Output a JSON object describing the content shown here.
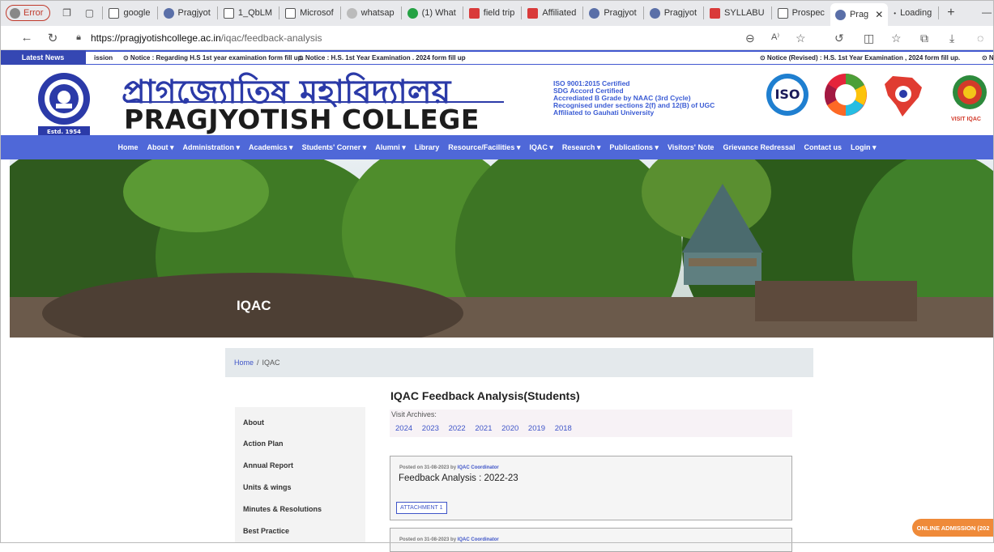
{
  "browser": {
    "error_label": "Error",
    "tabs": [
      {
        "label": "google",
        "icon": "doc"
      },
      {
        "label": "Pragjyot",
        "icon": "globe"
      },
      {
        "label": "1_QbLM",
        "icon": "doc"
      },
      {
        "label": "Microsof",
        "icon": "doc"
      },
      {
        "label": "whatsap",
        "icon": "search"
      },
      {
        "label": "(1) What",
        "icon": "whatsapp"
      },
      {
        "label": "field trip",
        "icon": "pdf"
      },
      {
        "label": "Affiliated",
        "icon": "pdf"
      },
      {
        "label": "Pragjyot",
        "icon": "globe"
      },
      {
        "label": "Pragjyot",
        "icon": "globe"
      },
      {
        "label": "SYLLABU",
        "icon": "pdf"
      },
      {
        "label": "Prospec",
        "icon": "doc"
      }
    ],
    "active_tab": "Prag",
    "loading_tab": "Loading",
    "url_host": "https://pragjyotishcollege.ac.in",
    "url_path": "/iqac/feedback-analysis"
  },
  "news": {
    "label": "Latest News",
    "items": [
      "ission",
      "⊙ Notice : Regarding H.S 1st year examination form fill up.",
      "⊙ Notice : H.S. 1st Year Examination . 2024 form fill up",
      "⊙ Notice (Revised) : H.S. 1st Year Examination , 2024 form fill up.",
      "⊙ N"
    ]
  },
  "header": {
    "title_bn": "প্রাগজ্যোতিষ মহাবিদ্যালয়",
    "title_en": "PRAGJYOTISH COLLEGE",
    "estd": "Estd. 1954",
    "accreditations": [
      "ISO 9001:2015 Certified",
      "SDG Accord Certified",
      "Accrediated B Grade by NAAC (3rd Cycle)",
      "Recognised under sections 2(f) and 12(B) of UGC",
      "Affiliated to Gauhati University"
    ],
    "iso_label": "ISO",
    "visit_iqac": "VISIT IQAC"
  },
  "nav": [
    "Home",
    "About ▾",
    "Administration ▾",
    "Academics ▾",
    "Students' Corner ▾",
    "Alumni ▾",
    "Library",
    "Resource/Facilities ▾",
    "IQAC ▾",
    "Research ▾",
    "Publications ▾",
    "Visitors' Note",
    "Grievance Redressal",
    "Contact us",
    "Login ▾"
  ],
  "hero": {
    "title": "IQAC"
  },
  "breadcrumb": {
    "home": "Home",
    "sep": "/",
    "current": "IQAC"
  },
  "sidebar": [
    "About",
    "Action Plan",
    "Annual Report",
    "Units & wings",
    "Minutes & Resolutions",
    "Best Practice"
  ],
  "main": {
    "title": "IQAC Feedback Analysis(Students)",
    "archives_label": "Visit Archives:",
    "years": [
      "2024",
      "2023",
      "2022",
      "2021",
      "2020",
      "2019",
      "2018"
    ],
    "posts": [
      {
        "meta_prefix": "Posted on 31-08-2023 by",
        "author": "IQAC Coordinator",
        "title": "Feedback Analysis : 2022-23",
        "attachment": "ATTACHMENT 1"
      },
      {
        "meta_prefix": "Posted on 31-08-2023 by",
        "author": "IQAC Coordinator",
        "title": "",
        "attachment": ""
      }
    ]
  },
  "admission_button": "ONLINE ADMISSION (202"
}
